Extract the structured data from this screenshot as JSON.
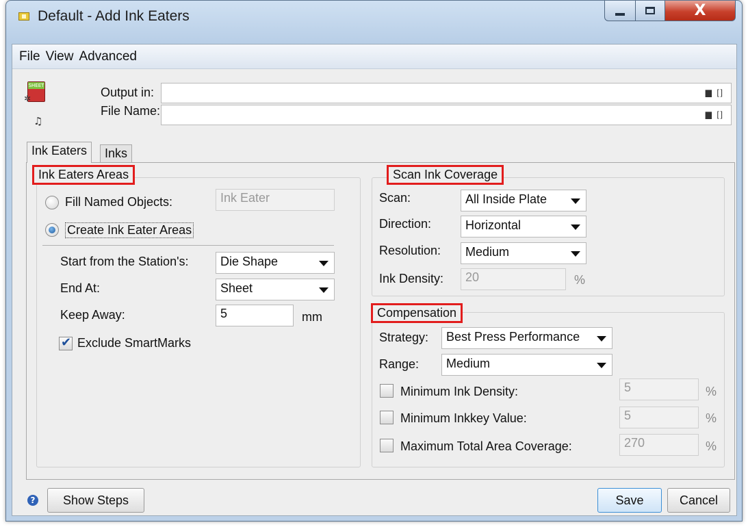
{
  "window": {
    "title": "Default - Add Ink Eaters",
    "close_glyph": "X"
  },
  "menu": {
    "items": [
      "File",
      "View",
      "Advanced"
    ]
  },
  "header": {
    "output_label": "Output in:",
    "output_value": "",
    "filename_label": "File Name:",
    "filename_value": "",
    "field_icons": "▆ []",
    "sheet_icon_text": "SHEET"
  },
  "tabs": [
    "Ink Eaters",
    "Inks"
  ],
  "ink_eater_areas": {
    "title": "Ink Eaters Areas",
    "fill_named_label": "Fill Named Objects:",
    "fill_named_value": "Ink Eater",
    "create_label": "Create Ink Eater Areas",
    "start_label": "Start from the Station's:",
    "start_value": "Die Shape",
    "end_label": "End At:",
    "end_value": "Sheet",
    "keep_away_label": "Keep Away:",
    "keep_away_value": "5",
    "keep_away_unit": "mm",
    "exclude_label": "Exclude SmartMarks"
  },
  "scan": {
    "title": "Scan Ink Coverage",
    "scan_label": "Scan:",
    "scan_value": "All Inside Plate",
    "direction_label": "Direction:",
    "direction_value": "Horizontal",
    "resolution_label": "Resolution:",
    "resolution_value": "Medium",
    "density_label": "Ink Density:",
    "density_value": "20",
    "density_unit": "%"
  },
  "compensation": {
    "title": "Compensation",
    "strategy_label": "Strategy:",
    "strategy_value": "Best Press Performance",
    "range_label": "Range:",
    "range_value": "Medium",
    "min_density_label": "Minimum Ink Density:",
    "min_density_value": "5",
    "min_inkkey_label": "Minimum Inkkey Value:",
    "min_inkkey_value": "5",
    "max_coverage_label": "Maximum Total Area Coverage:",
    "max_coverage_value": "270",
    "unit": "%"
  },
  "footer": {
    "help_glyph": "?",
    "show_steps": "Show Steps",
    "save": "Save",
    "cancel": "Cancel"
  }
}
